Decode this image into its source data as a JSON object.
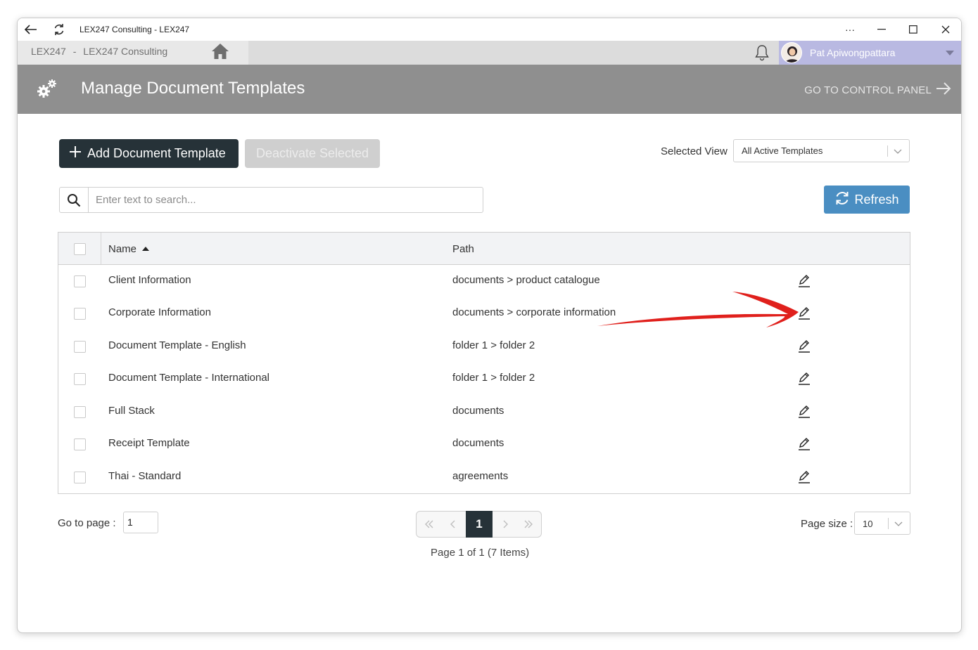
{
  "window": {
    "title": "LEX247 Consulting - LEX247"
  },
  "appbar": {
    "org_short": "LEX247",
    "separator": "-",
    "org_name": "LEX247 Consulting",
    "user_name": "Pat Apiwongpattara"
  },
  "header": {
    "title": "Manage Document Templates",
    "control_panel_link": "GO TO CONTROL PANEL"
  },
  "toolbar": {
    "add_label": "Add Document Template",
    "deactivate_label": "Deactivate Selected",
    "selected_view_label": "Selected View",
    "selected_view_value": "All Active Templates",
    "search_placeholder": "Enter text to search...",
    "refresh_label": "Refresh"
  },
  "table": {
    "columns": {
      "name": "Name",
      "path": "Path"
    },
    "rows": [
      {
        "name": "Client Information",
        "path": "documents > product catalogue"
      },
      {
        "name": "Corporate Information",
        "path": "documents > corporate information"
      },
      {
        "name": "Document Template - English",
        "path": "folder 1 > folder 2"
      },
      {
        "name": "Document Template - International",
        "path": "folder 1 > folder 2"
      },
      {
        "name": "Full Stack",
        "path": "documents"
      },
      {
        "name": "Receipt Template",
        "path": "documents"
      },
      {
        "name": "Thai - Standard",
        "path": "agreements"
      }
    ]
  },
  "pagination": {
    "goto_label": "Go to page :",
    "goto_value": "1",
    "current_page": "1",
    "info": "Page 1 of 1 (7 Items)",
    "page_size_label": "Page size :",
    "page_size_value": "10"
  },
  "colors": {
    "header_bg": "#8f8f8f",
    "primary_dark": "#263238",
    "refresh_blue": "#4a8ec2",
    "user_bar": "#b9b9e2",
    "annotation_red": "#e0201c"
  }
}
